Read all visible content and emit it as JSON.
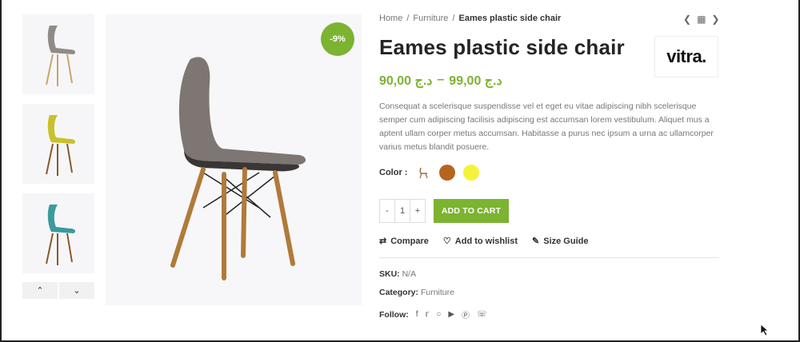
{
  "badge": "-9%",
  "breadcrumb": {
    "home": "Home",
    "sep": "/",
    "category": "Furniture",
    "current": "Eames plastic side chair"
  },
  "product": {
    "title": "Eames plastic side chair",
    "brand": "vitra.",
    "price_low": "90,00 د.ج",
    "price_dash": "–",
    "price_high": "99,00 د.ج",
    "description": "Consequat a scelerisque suspendisse vel et eget eu vitae adipiscing nibh scelerisque semper cum adipiscing facilisis adipiscing est accumsan lorem vestibulum. Aliquet mus a aptent ullam corper metus accumsan. Habitasse a purus nec ipsum a urna ac ullamcorper varius metus blandit posuere."
  },
  "color": {
    "label": "Color :",
    "swatches": [
      "#b5651d",
      "#f5f23a"
    ]
  },
  "quantity": {
    "minus": "-",
    "value": "1",
    "plus": "+"
  },
  "cart_button": "ADD TO CART",
  "actions": {
    "compare": "Compare",
    "wishlist": "Add to wishlist",
    "size_guide": "Size Guide"
  },
  "meta": {
    "sku_label": "SKU:",
    "sku_value": "N/A",
    "category_label": "Category:",
    "category_value": "Furniture",
    "follow_label": "Follow:"
  },
  "social": [
    "f",
    "t",
    "ig",
    "yt",
    "p",
    "wa"
  ],
  "colors": {
    "accent": "#7cb331"
  }
}
